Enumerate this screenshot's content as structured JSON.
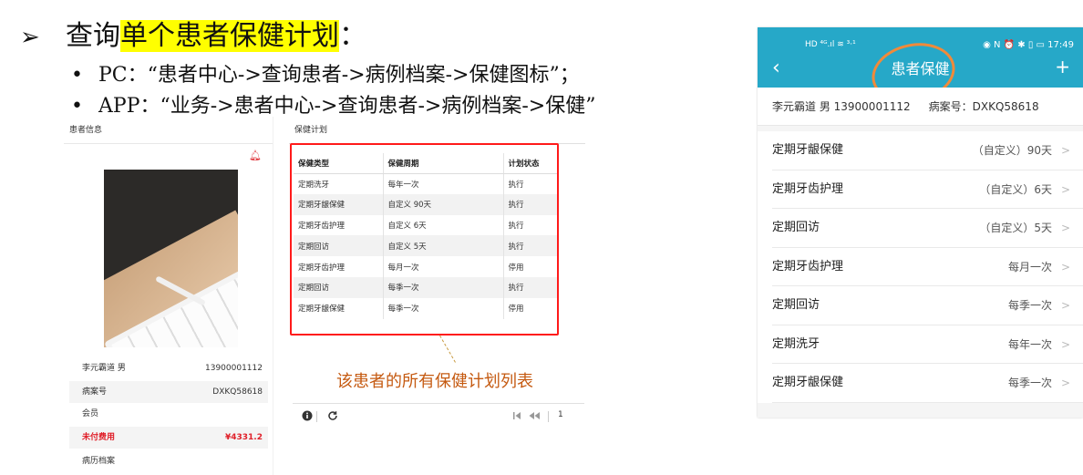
{
  "header": {
    "arrow": "➢",
    "title_prefix": "查询",
    "title_highlight": "单个患者保健计划",
    "title_suffix": "：",
    "bullet_pc": "PC：“患者中心->查询患者->病例档案->保健图标”；",
    "bullet_app": "APP：“业务->患者中心->查询患者->病例档案->保健”",
    "bullet_dot": "•"
  },
  "pc_left": {
    "panel_title": "患者信息",
    "rows": [
      {
        "label": "李元霸道 男",
        "value": "13900001112"
      },
      {
        "label": "病案号",
        "value": "DXKQ58618"
      },
      {
        "label": "会员",
        "value": ""
      },
      {
        "label": "未付费用",
        "value": "¥4331.2"
      },
      {
        "label": "病历档案",
        "value": ""
      }
    ]
  },
  "pc_right": {
    "panel_title": "保健计划",
    "columns": [
      "保健类型",
      "保健周期",
      "计划状态"
    ],
    "rows": [
      [
        "定期洗牙",
        "每年一次",
        "执行"
      ],
      [
        "定期牙龈保健",
        "自定义 90天",
        "执行"
      ],
      [
        "定期牙齿护理",
        "自定义 6天",
        "执行"
      ],
      [
        "定期回访",
        "自定义 5天",
        "执行"
      ],
      [
        "定期牙齿护理",
        "每月一次",
        "停用"
      ],
      [
        "定期回访",
        "每季一次",
        "执行"
      ],
      [
        "定期牙龈保健",
        "每季一次",
        "停用"
      ]
    ],
    "caption": "该患者的所有保健计划列表",
    "pager_page": "1"
  },
  "mobile": {
    "status_left": "HD ⁴ᴳ.ıl ≋ ³·¹",
    "status_right": "◉ N ⏰ ✱ ▯ ▭ 17:49",
    "title": "患者保健",
    "back": "‹",
    "plus": "+",
    "patient_name": "李元霸道 男  13900001112",
    "patient_no": "病案号：DXKQ58618",
    "items": [
      {
        "label": "定期牙龈保健",
        "value": "（自定义）90天"
      },
      {
        "label": "定期牙齿护理",
        "value": "（自定义）6天"
      },
      {
        "label": "定期回访",
        "value": "（自定义）5天"
      },
      {
        "label": "定期牙齿护理",
        "value": "每月一次"
      },
      {
        "label": "定期回访",
        "value": "每季一次"
      },
      {
        "label": "定期洗牙",
        "value": "每年一次"
      },
      {
        "label": "定期牙龈保健",
        "value": "每季一次"
      }
    ]
  },
  "colors": {
    "highlight": "#ffff00",
    "red_box": "#ff1a1a",
    "caption": "#c55a11",
    "app_bar": "#26a8c8",
    "annotation_circle": "#f08a3a",
    "unpaid": "#e0202a"
  }
}
